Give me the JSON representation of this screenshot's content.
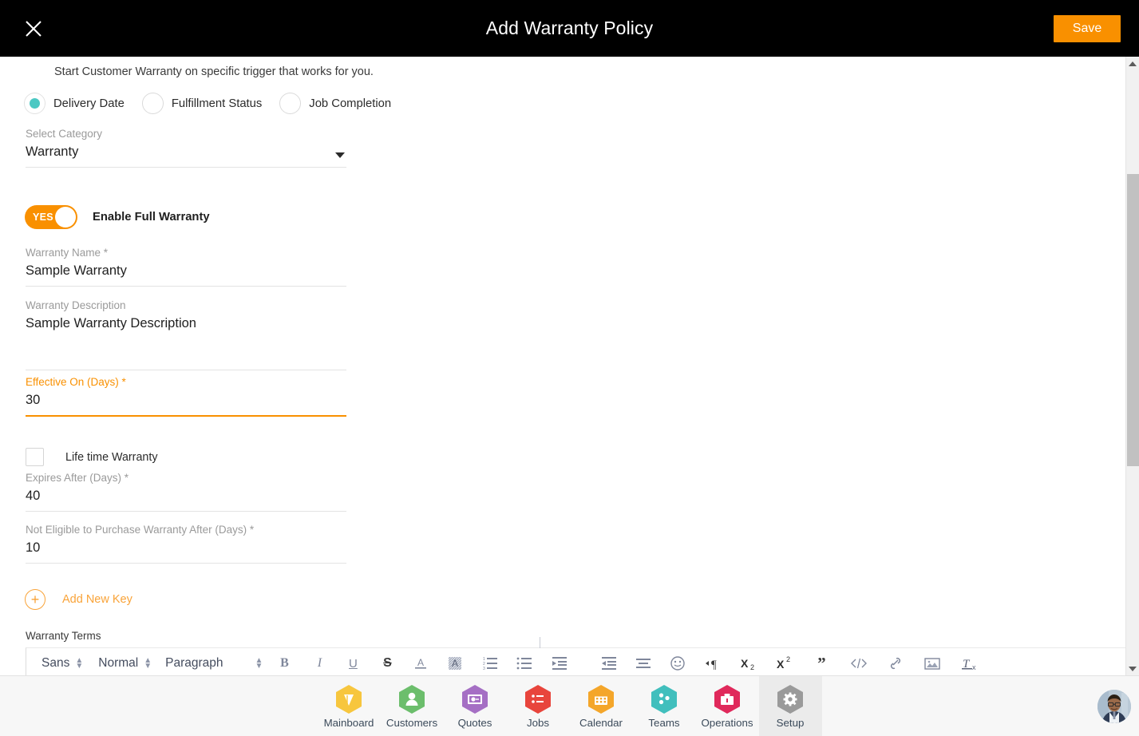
{
  "header": {
    "title": "Add Warranty Policy",
    "close_icon": "close-icon",
    "save_label": "Save",
    "save_color": "#F99000",
    "background": "#000000"
  },
  "form": {
    "helper_text": "Start Customer Warranty on specific trigger that works for you.",
    "trigger_options": [
      {
        "label": "Delivery Date",
        "selected": true
      },
      {
        "label": "Fulfillment Status",
        "selected": false
      },
      {
        "label": "Job Completion",
        "selected": false
      }
    ],
    "selected_radio_color": "#4BC8C3",
    "category": {
      "label": "Select Category",
      "value": "Warranty",
      "caret_icon": "chevron-down-icon"
    },
    "enable_full_warranty": {
      "toggle_text": "YES",
      "label": "Enable Full Warranty",
      "on": true,
      "color": "#F99000"
    },
    "fields": [
      {
        "label": "Warranty Name *",
        "value": "Sample Warranty",
        "focused": false
      },
      {
        "label": "Warranty Description",
        "value": "Sample Warranty Description",
        "focused": false
      },
      {
        "label": "Effective On (Days) *",
        "value": "30",
        "focused": true
      },
      {
        "label": "Expires After (Days) *",
        "value": "40",
        "focused": false
      },
      {
        "label": "Not Eligible to Purchase Warranty After (Days) *",
        "value": "10",
        "focused": false
      }
    ],
    "lifetime_warranty": {
      "label": "Life time Warranty",
      "checked": false
    },
    "add_new_key": {
      "label": "Add New Key",
      "icon": "plus-circle-icon",
      "color": "#F9A338"
    },
    "warranty_terms_label": "Warranty Terms"
  },
  "editor": {
    "font_family": "Sans",
    "font_size": "Normal",
    "block_format": "Paragraph",
    "tools": [
      "bold-icon",
      "italic-icon",
      "underline-icon",
      "strikethrough-icon",
      "text-color-icon",
      "background-color-icon",
      "ordered-list-icon",
      "bullet-list-icon",
      "outdent-icon",
      "indent-icon",
      "align-icon",
      "emoji-icon",
      "text-direction-icon",
      "subscript-icon",
      "superscript-icon",
      "blockquote-icon",
      "code-block-icon",
      "link-icon",
      "image-icon",
      "clear-format-icon"
    ]
  },
  "scrollbar": {
    "up_arrow": "scroll-up-arrow",
    "down_arrow": "scroll-down-arrow",
    "thumb": "scroll-thumb"
  },
  "bottom_nav": {
    "items": [
      {
        "label": "Mainboard",
        "icon": "mainboard-icon",
        "color": "#F7C63E",
        "active": false
      },
      {
        "label": "Customers",
        "icon": "customers-icon",
        "color": "#6CBE6C",
        "active": false
      },
      {
        "label": "Quotes",
        "icon": "quotes-icon",
        "color": "#A56FC4",
        "active": false
      },
      {
        "label": "Jobs",
        "icon": "jobs-icon",
        "color": "#E8453C",
        "active": false
      },
      {
        "label": "Calendar",
        "icon": "calendar-icon",
        "color": "#F4A62A",
        "active": false
      },
      {
        "label": "Teams",
        "icon": "teams-icon",
        "color": "#41BFBD",
        "active": false
      },
      {
        "label": "Operations",
        "icon": "operations-icon",
        "color": "#E0295B",
        "active": false
      },
      {
        "label": "Setup",
        "icon": "gear-icon",
        "color": "#9A9A9A",
        "active": true
      }
    ],
    "avatar": "user-avatar"
  }
}
